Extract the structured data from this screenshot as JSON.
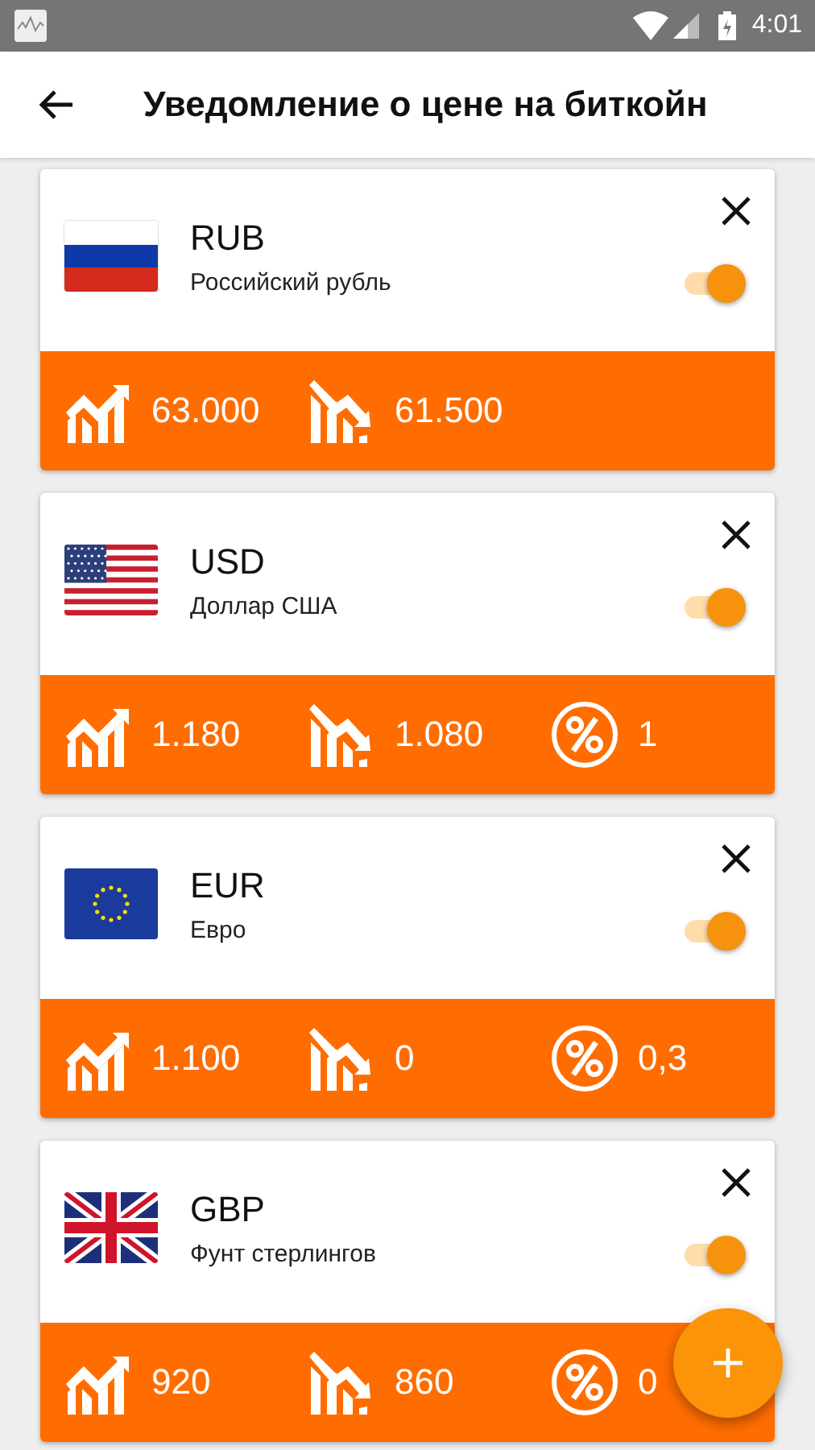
{
  "status_bar": {
    "time": "4:01"
  },
  "app_bar": {
    "title": "Уведомление о цене на биткойн"
  },
  "alerts": [
    {
      "code": "RUB",
      "name": "Российский рубль",
      "flag": {
        "kind": "ru"
      },
      "on": true,
      "stats": [
        {
          "kind": "up",
          "value": "63.000"
        },
        {
          "kind": "down",
          "value": "61.500"
        }
      ]
    },
    {
      "code": "USD",
      "name": "Доллар США",
      "flag": {
        "kind": "us"
      },
      "on": true,
      "stats": [
        {
          "kind": "up",
          "value": "1.180"
        },
        {
          "kind": "down",
          "value": "1.080"
        },
        {
          "kind": "percent",
          "value": "1"
        }
      ]
    },
    {
      "code": "EUR",
      "name": "Евро",
      "flag": {
        "kind": "eu"
      },
      "on": true,
      "stats": [
        {
          "kind": "up",
          "value": "1.100"
        },
        {
          "kind": "down",
          "value": "0"
        },
        {
          "kind": "percent",
          "value": "0,3"
        }
      ]
    },
    {
      "code": "GBP",
      "name": "Фунт стерлингов",
      "flag": {
        "kind": "gb"
      },
      "on": true,
      "stats": [
        {
          "kind": "up",
          "value": "920"
        },
        {
          "kind": "down",
          "value": "860"
        },
        {
          "kind": "percent",
          "value": "0"
        }
      ]
    }
  ]
}
